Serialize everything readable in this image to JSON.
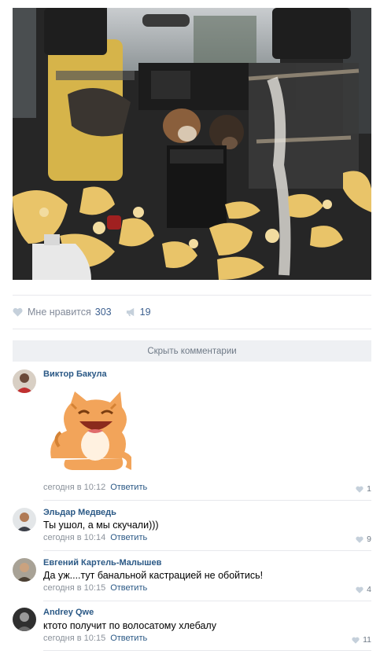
{
  "post": {
    "photo_alt_icon": "photo-dogs-destroyed-car-interior",
    "likes_label": "Мне нравится",
    "likes_count": "303",
    "shares_count": "19",
    "hide_comments_label": "Скрыть комментарии"
  },
  "comments": [
    {
      "author": "Виктор Бакула",
      "text": "",
      "sticker": "cat-laughing-sticker",
      "date": "сегодня в 10:12",
      "reply": "Ответить",
      "likes": "1"
    },
    {
      "author": "Эльдар Медведь",
      "text": "Ты ушол, а мы скучали)))",
      "date": "сегодня в 10:14",
      "reply": "Ответить",
      "likes": "9"
    },
    {
      "author": "Евгений Картель-Малышев",
      "text": "Да уж....тут банальной кастрацией не обойтись!",
      "date": "сегодня в 10:15",
      "reply": "Ответить",
      "likes": "4"
    },
    {
      "author": "Andrey Qwe",
      "text": "ктото получит по волосатому хлебалу",
      "date": "сегодня в 10:15",
      "reply": "Ответить",
      "likes": "11"
    }
  ],
  "colors": {
    "link": "#2a5885",
    "muted": "#828a99",
    "bar": "#eef0f3"
  }
}
